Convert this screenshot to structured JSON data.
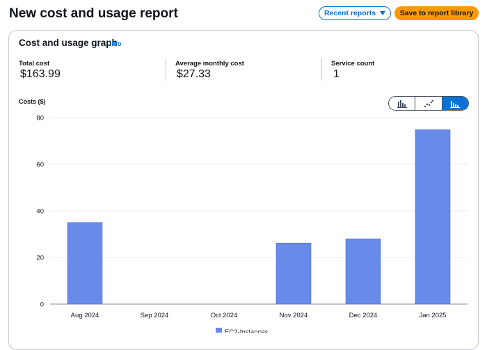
{
  "header": {
    "title": "New cost and usage report",
    "recent_reports_label": "Recent reports",
    "save_label": "Save to report library"
  },
  "graph": {
    "title": "Cost and usage graph",
    "info_label": "Info"
  },
  "metrics": [
    {
      "label": "Total cost",
      "value": "$163.99"
    },
    {
      "label": "Average monthly cost",
      "value": "$27.33"
    },
    {
      "label": "Service count",
      "value": "1"
    }
  ],
  "chart_controls": {
    "selected": "stacked-bar",
    "options": [
      "bar",
      "line",
      "stacked-bar"
    ]
  },
  "colors": {
    "accent": "#0972d3",
    "save": "#ff9900",
    "bar": "#688ae8"
  },
  "chart_data": {
    "type": "bar",
    "ylabel": "Costs ($)",
    "categories": [
      "Aug 2024",
      "Sep 2024",
      "Oct 2024",
      "Nov 2024",
      "Dec 2024",
      "Jan 2025"
    ],
    "series": [
      {
        "name": "EC2-Instances",
        "values": [
          35.0,
          0,
          0,
          26.2,
          28.0,
          74.8
        ]
      }
    ],
    "ylim": [
      0,
      80
    ],
    "yticks": [
      0,
      20,
      40,
      60,
      80
    ],
    "grid": true,
    "legend": "bottom"
  }
}
